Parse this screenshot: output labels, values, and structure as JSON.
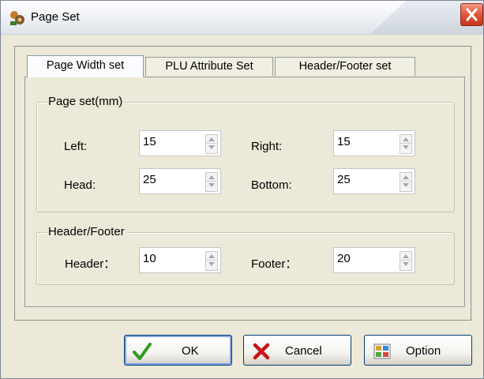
{
  "window": {
    "title": "Page Set",
    "app_icon": "settings-app-icon",
    "close_icon": "close-icon"
  },
  "tabs": [
    {
      "label": "Page Width set",
      "active": true
    },
    {
      "label": "PLU Attribute Set",
      "active": false
    },
    {
      "label": "Header/Footer set",
      "active": false
    }
  ],
  "page_set": {
    "legend": "Page set(mm)",
    "left": {
      "label": "Left:",
      "value": "15"
    },
    "right": {
      "label": "Right:",
      "value": "15"
    },
    "head": {
      "label": "Head:",
      "value": "25"
    },
    "bottom": {
      "label": "Bottom:",
      "value": "25"
    }
  },
  "header_footer": {
    "legend": "Header/Footer",
    "header": {
      "label": "Header：",
      "value": "10"
    },
    "footer": {
      "label": "Footer：",
      "value": "20"
    }
  },
  "buttons": {
    "ok": {
      "label": "OK",
      "icon": "checkmark-icon"
    },
    "cancel": {
      "label": "Cancel",
      "icon": "x-icon"
    },
    "option": {
      "label": "Option",
      "icon": "option-image-icon"
    }
  },
  "colors": {
    "close_button": "#e0543a",
    "ok_check": "#2f9a23",
    "cancel_x": "#c8141b",
    "default_focus": "#7ea4e8"
  }
}
